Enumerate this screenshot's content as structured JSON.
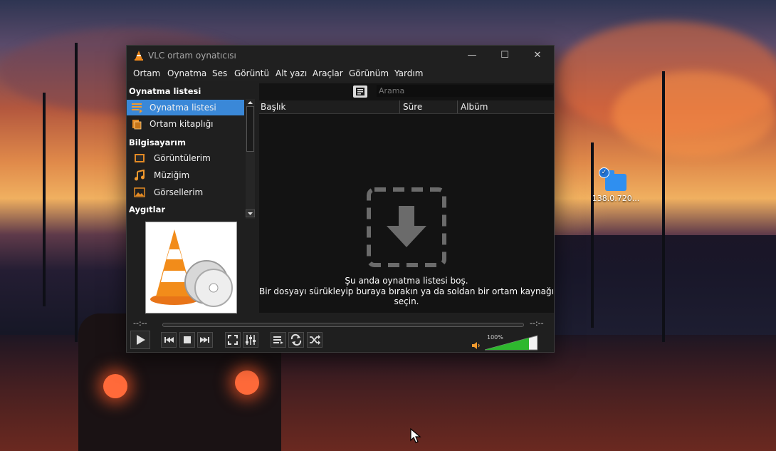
{
  "window": {
    "title": "VLC ortam oynatıcısı"
  },
  "menu": [
    {
      "label": "Ortam",
      "name": "menu-media"
    },
    {
      "label": "Oynatma",
      "name": "menu-playback"
    },
    {
      "label": "Ses",
      "name": "menu-audio"
    },
    {
      "label": "Görüntü",
      "name": "menu-video"
    },
    {
      "label": "Alt yazı",
      "name": "menu-subtitle"
    },
    {
      "label": "Araçlar",
      "name": "menu-tools"
    },
    {
      "label": "Görünüm",
      "name": "menu-view"
    },
    {
      "label": "Yardım",
      "name": "menu-help"
    }
  ],
  "sidebar": {
    "playlist_header": "Oynatma listesi",
    "items_top": [
      {
        "label": "Oynatma listesi",
        "icon": "playlist-icon",
        "selected": true
      },
      {
        "label": "Ortam kitaplığı",
        "icon": "media-library-icon",
        "selected": false
      }
    ],
    "computer_header": "Bilgisayarım",
    "items_computer": [
      {
        "label": "Görüntülerim",
        "icon": "videos-icon"
      },
      {
        "label": "Müziğim",
        "icon": "music-icon"
      },
      {
        "label": "Görsellerim",
        "icon": "pictures-icon"
      }
    ],
    "devices_header": "Aygıtlar"
  },
  "search": {
    "placeholder": "Arama"
  },
  "columns": [
    "Başlık",
    "Süre",
    "Albüm"
  ],
  "empty": {
    "line1": "Şu anda oynatma listesi boş.",
    "line2": "Bir dosyayı sürükleyip buraya bırakın ya da soldan bir ortam kaynağı seçin."
  },
  "player": {
    "time_elapsed": "--:--",
    "time_total": "--:--",
    "volume_percent": "100%",
    "volume_level": 1.0
  },
  "desktop": {
    "icon_label": "138.0.720..."
  },
  "colors": {
    "accent": "#3a88d8",
    "volume": "#2eb82e"
  }
}
